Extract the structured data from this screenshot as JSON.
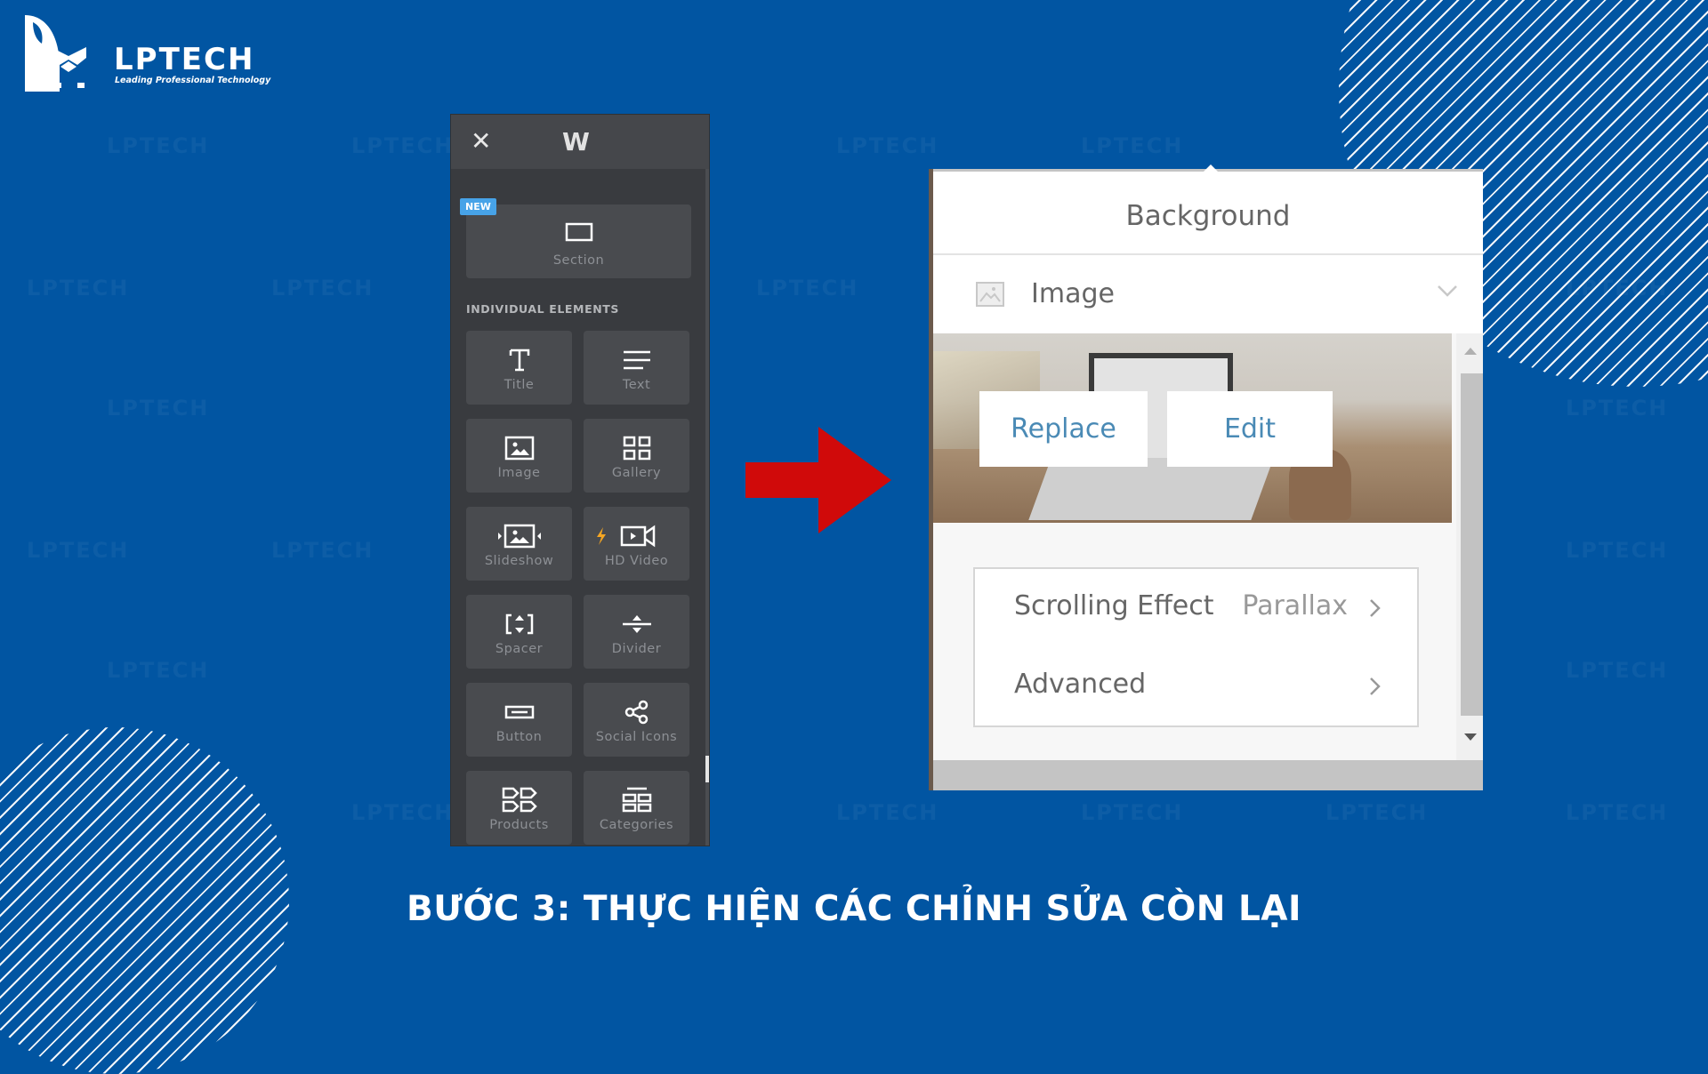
{
  "brand": {
    "name": "LPTECH",
    "tagline": "Leading Professional Technology",
    "colors": {
      "background": "#0155a2",
      "arrow": "#d00a0a",
      "accent_link": "#4a8ab5",
      "new_badge": "#47a3e8"
    }
  },
  "watermark_text": "LPTECH",
  "left_panel": {
    "close_icon": "✕",
    "app_logo": "W",
    "new_badge": "NEW",
    "section_tile": {
      "label": "Section",
      "icon": "rectangle-icon"
    },
    "heading": "INDIVIDUAL ELEMENTS",
    "elements": [
      {
        "label": "Title",
        "icon": "title-icon"
      },
      {
        "label": "Text",
        "icon": "text-lines-icon"
      },
      {
        "label": "Image",
        "icon": "image-icon"
      },
      {
        "label": "Gallery",
        "icon": "gallery-grid-icon"
      },
      {
        "label": "Slideshow",
        "icon": "slideshow-icon"
      },
      {
        "label": "HD Video",
        "icon": "video-camera-icon"
      },
      {
        "label": "Spacer",
        "icon": "spacer-icon"
      },
      {
        "label": "Divider",
        "icon": "divider-icon"
      },
      {
        "label": "Button",
        "icon": "button-icon"
      },
      {
        "label": "Social Icons",
        "icon": "share-icon"
      },
      {
        "label": "Products",
        "icon": "tags-icon"
      },
      {
        "label": "Categories",
        "icon": "categories-icon"
      }
    ]
  },
  "background_panel": {
    "title": "Background",
    "type_select": {
      "value": "Image",
      "icon": "image-icon"
    },
    "buttons": {
      "replace": "Replace",
      "edit": "Edit"
    },
    "options": [
      {
        "label": "Scrolling Effect",
        "value": "Parallax"
      },
      {
        "label": "Advanced",
        "value": ""
      }
    ]
  },
  "caption": "BƯỚC 3: THỰC HIỆN CÁC CHỈNH SỬA CÒN LẠI"
}
